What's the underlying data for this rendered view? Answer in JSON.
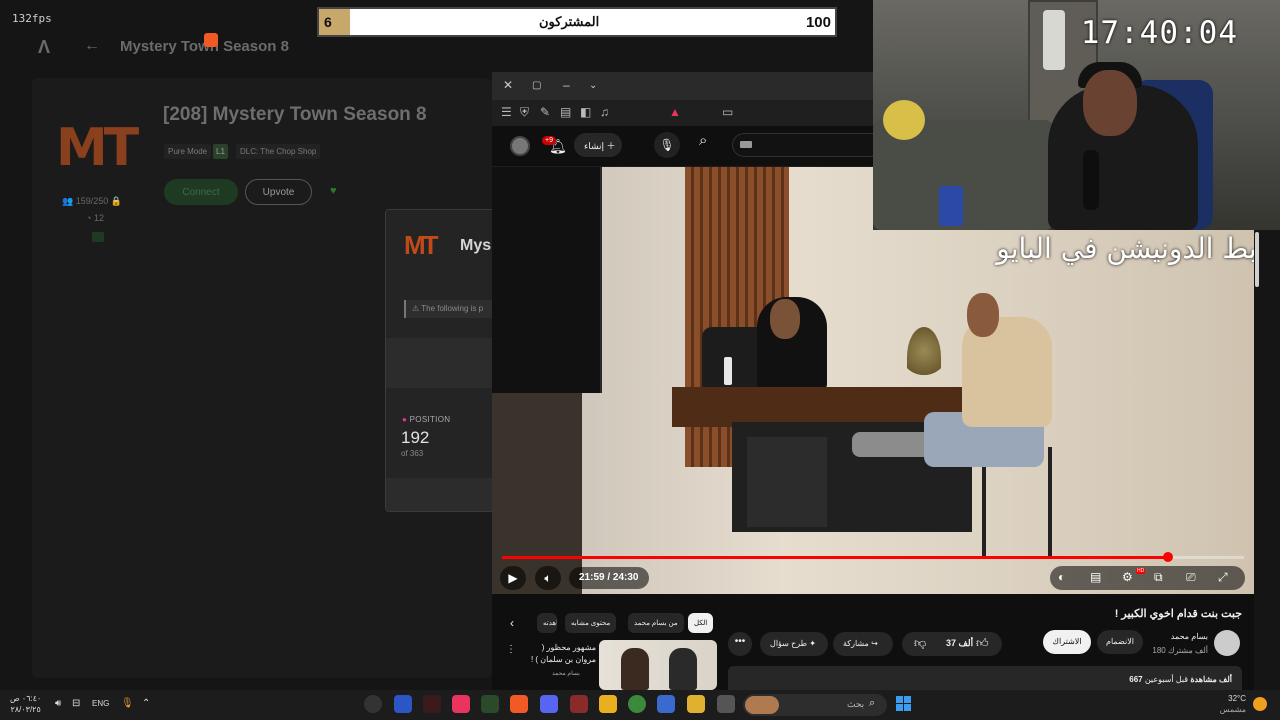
{
  "overlay": {
    "fps": "132fps",
    "clock": "17:40:04",
    "donation_text": "رابط الدونيشن في البايو",
    "subscribers": {
      "current": "6",
      "label": "المشتركون",
      "goal": "100"
    }
  },
  "launcher": {
    "topbar_title": "Mystery Town Season 8",
    "logo_text": "MT",
    "server_title": "[208] Mystery Town Season 8",
    "tags": [
      "Pure Mode",
      "L1",
      "DLC: The Chop Shop"
    ],
    "connect_label": "Connect",
    "upvote_label": "Upvote",
    "players": "159/250",
    "ping": "12",
    "dialog": {
      "logo_text": "MT",
      "title": "Mys",
      "warning": "The following is p",
      "position_label": "POSITION",
      "position_value": "192",
      "position_of": "of 363"
    }
  },
  "browser": {
    "youtube": {
      "notif_count": "+9",
      "create_label": "إنشاء",
      "video": {
        "current_time": "21:59",
        "duration": "24:30",
        "time_display": "21:59 / 24:30",
        "progress_fraction": 0.897
      },
      "title": "جبت بنت قدام اخوي الكبير !",
      "channel_name": "بسام محمد",
      "channel_subs": "180 ألف مشترك",
      "subscribed_label": "الاشتراك",
      "join_label": "الانضمام",
      "like_count": "37 ألف",
      "share_label": "مشاركة",
      "ask_label": "طرح سؤال",
      "views": "667 ألف مشاهدة",
      "views_time": "قبل أسبوعين",
      "chips": [
        "الكل",
        "من بسام محمد",
        "محتوى مشابه",
        "تمت مشاهدته"
      ],
      "recommended": {
        "title": "مشهور محظور ( مروان بن سلمان ) !",
        "channel": "بسام محمد"
      }
    }
  },
  "taskbar": {
    "time": "٠٦:٤٠ ص",
    "date": "٢٨/٠٣/٢٥",
    "lang": "ENG",
    "search_placeholder": "بحث",
    "weather_temp": "32°C",
    "weather_desc": "مشمس"
  },
  "colors": {
    "accent_red": "#ff0000",
    "mt_orange": "#c04a18",
    "sub_gold": "#c8a86a"
  }
}
